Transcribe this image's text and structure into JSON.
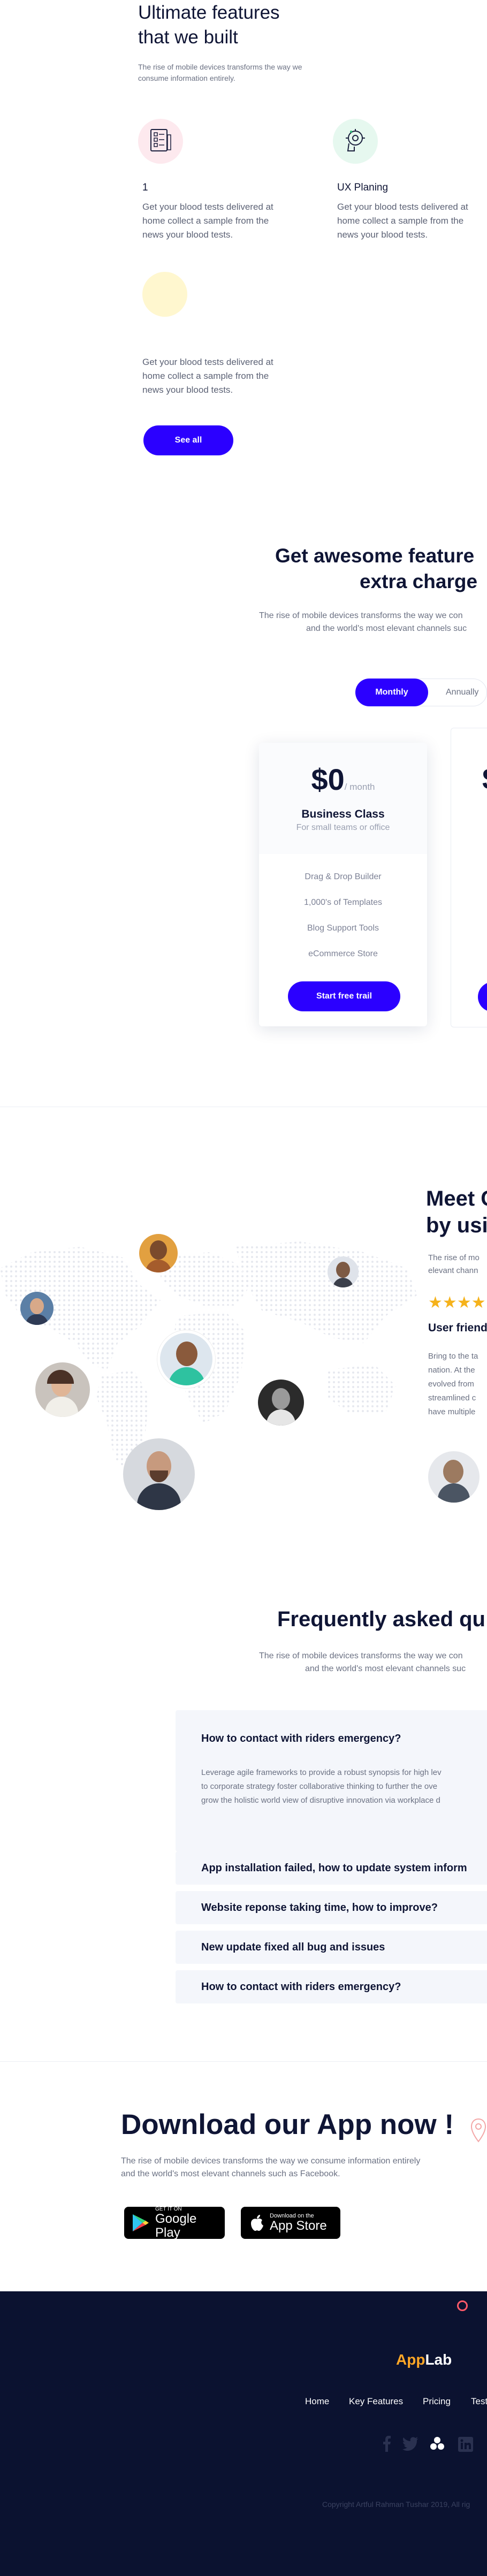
{
  "features": {
    "title_line1": "Ultimate features",
    "title_line2": "that we built",
    "subtitle_line1": "The rise of mobile devices transforms the way we",
    "subtitle_line2": "consume information entirely.",
    "items": [
      {
        "icon": "checklist-icon",
        "title": "1",
        "line1": "Get your blood tests delivered at",
        "line2": "home collect a sample from the",
        "line3": "news your blood tests."
      },
      {
        "icon": "brain-gear-icon",
        "title": "UX Planing",
        "line1": "Get your blood tests delivered at",
        "line2": "home collect a sample from the",
        "line3": "news your blood tests."
      },
      {
        "icon": "",
        "title": "",
        "line1": "Get your blood tests delivered at",
        "line2": "home collect a sample from the",
        "line3": "news your blood tests."
      }
    ],
    "see_all_label": "See all"
  },
  "pricing": {
    "title_line1": "Get awesome feature",
    "title_line2": "extra charge",
    "subtitle_line1": "The rise of mobile devices transforms the way we con",
    "subtitle_line2": "and the world's most elevant channels suc",
    "toggle_monthly": "Monthly",
    "toggle_annually": "Annually",
    "plan": {
      "price": "$0",
      "period": "/ month",
      "name": "Business Class",
      "desc": "For small teams or office",
      "features": [
        "Drag & Drop Builder",
        "1,000's of Templates",
        "Blog Support Tools",
        "eCommerce Store"
      ],
      "cta": "Start free trail"
    },
    "next_price": "$"
  },
  "testimonials": {
    "title_line1": "Meet C",
    "title_line2": "by usi",
    "subtitle_line1": "The rise of mo",
    "subtitle_line2": "elevant chann",
    "rating": 4,
    "review_title": "User friend",
    "review_lines": [
      "Bring to the ta",
      "nation. At the",
      "evolved from",
      "streamlined c",
      "have multiple"
    ]
  },
  "faq": {
    "title": "Frequently asked qu",
    "subtitle_line1": "The rise of mobile devices transforms the way we con",
    "subtitle_line2": "and the world's most elevant channels suc",
    "open_question": "How to contact with riders emergency?",
    "open_answer_lines": [
      "Leverage agile frameworks to provide a robust synopsis for high lev",
      "to corporate strategy foster collaborative thinking to further the ove",
      "grow the holistic world view of disruptive innovation via workplace d"
    ],
    "questions": [
      "App installation failed, how to update system inform",
      "Website reponse taking time, how to improve?",
      "New update fixed all bug and issues",
      "How to contact with riders emergency?"
    ]
  },
  "download": {
    "title": "Download our App now !",
    "subtitle_line1": "The rise of mobile devices transforms the way we consume information entirely",
    "subtitle_line2": "and the world's most elevant channels such as Facebook.",
    "google_small": "GET IT ON",
    "google_big": "Google Play",
    "apple_small": "Download on the",
    "apple_big": "App Store"
  },
  "footer": {
    "logo_app": "App",
    "logo_lab": "Lab",
    "nav": [
      "Home",
      "Key Features",
      "Pricing",
      "Test"
    ],
    "copyright": "Copyright Artful Rahman Tushar 2019, All rig"
  },
  "colors": {
    "primary": "#2b00ff",
    "navy": "#0f1535",
    "footer_bg": "#0b1230",
    "logo_orange": "#ffa726",
    "star": "#f5b21b"
  }
}
